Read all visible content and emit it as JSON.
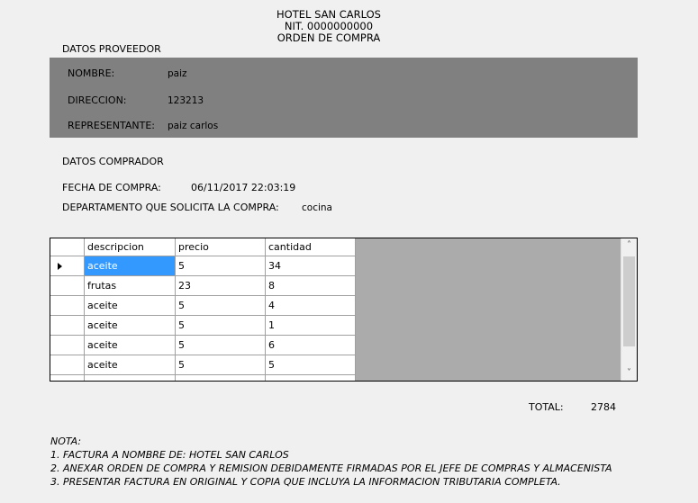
{
  "header": {
    "hotel": "HOTEL SAN CARLOS",
    "nit": "NIT. 0000000000",
    "doc_title": "ORDEN DE COMPRA"
  },
  "supplier": {
    "section_title": "DATOS PROVEEDOR",
    "name_label": "NOMBRE:",
    "name_value": "paiz",
    "address_label": "DIRECCION:",
    "address_value": "123213",
    "rep_label": "REPRESENTANTE:",
    "rep_value": "paiz carlos"
  },
  "buyer": {
    "section_title": "DATOS COMPRADOR",
    "date_label": "FECHA DE COMPRA:",
    "date_value": "06/11/2017 22:03:19",
    "dept_label": "DEPARTAMENTO QUE SOLICITA LA COMPRA:",
    "dept_value": "cocina"
  },
  "grid": {
    "columns": [
      "descripcion",
      "precio",
      "cantidad"
    ],
    "rows": [
      [
        "aceite",
        "5",
        "34"
      ],
      [
        "frutas",
        "23",
        "8"
      ],
      [
        "aceite",
        "5",
        "4"
      ],
      [
        "aceite",
        "5",
        "1"
      ],
      [
        "aceite",
        "5",
        "6"
      ],
      [
        "aceite",
        "5",
        "5"
      ]
    ],
    "scroll_up": "˄",
    "scroll_down": "˅"
  },
  "total": {
    "label": "TOTAL:",
    "value": "2784"
  },
  "notes": {
    "title": "NOTA:",
    "line1": "1. FACTURA A NOMBRE DE: HOTEL SAN CARLOS",
    "line2": "2. ANEXAR ORDEN DE COMPRA Y REMISION DEBIDAMENTE FIRMADAS POR EL JEFE DE COMPRAS Y ALMACENISTA",
    "line3": "3. PRESENTAR FACTURA EN ORIGINAL Y COPIA QUE INCLUYA LA INFORMACION TRIBUTARIA COMPLETA."
  }
}
